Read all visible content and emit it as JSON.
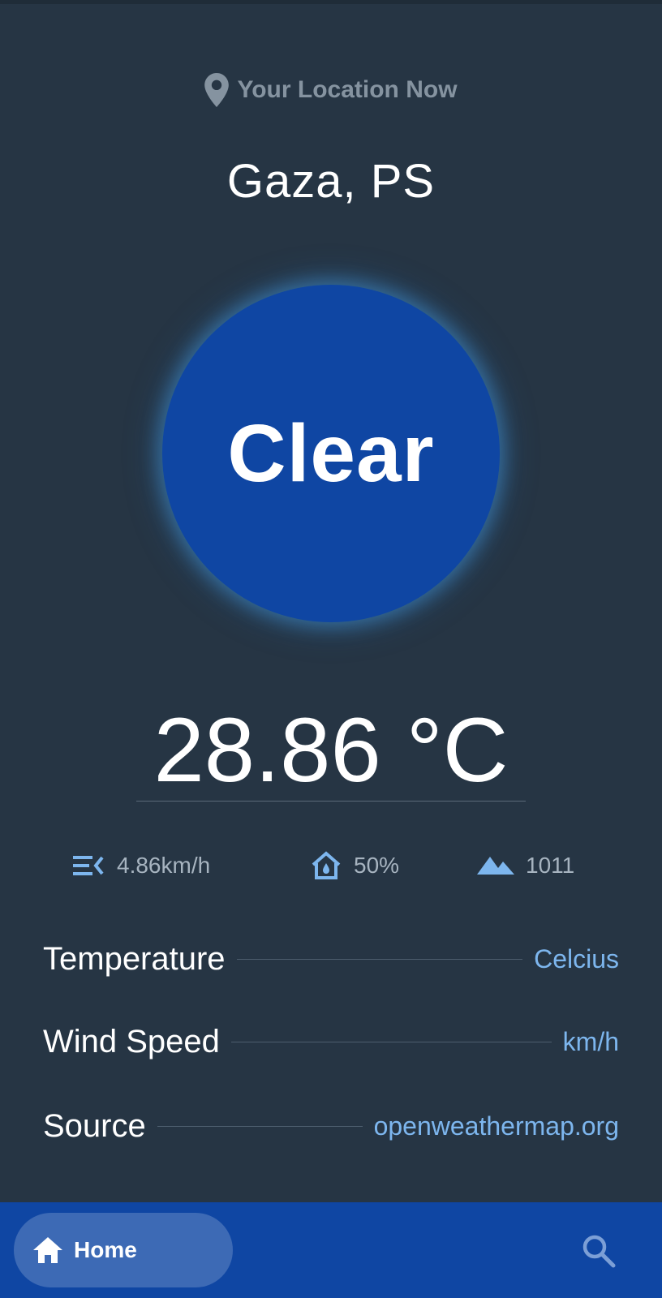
{
  "header": {
    "location_label": "Your Location Now",
    "icon": "location-pin-icon"
  },
  "city": "Gaza, PS",
  "condition": "Clear",
  "temperature": "28.86 °C",
  "stats": {
    "wind": {
      "icon": "wind-icon",
      "value": "4.86km/h"
    },
    "humidity": {
      "icon": "humidity-icon",
      "value": "50%"
    },
    "pressure": {
      "icon": "pressure-icon",
      "value": "1011"
    }
  },
  "settings": [
    {
      "label": "Temperature",
      "value": "Celcius"
    },
    {
      "label": "Wind Speed",
      "value": "km/h"
    },
    {
      "label": "Source",
      "value": "openweathermap.org"
    }
  ],
  "nav": {
    "home_label": "Home",
    "home_icon": "home-icon",
    "search_icon": "search-icon"
  },
  "colors": {
    "background": "#263544",
    "accent_blue": "#0f46a3",
    "link_blue": "#7db6ee",
    "muted_text": "#8593a0"
  }
}
